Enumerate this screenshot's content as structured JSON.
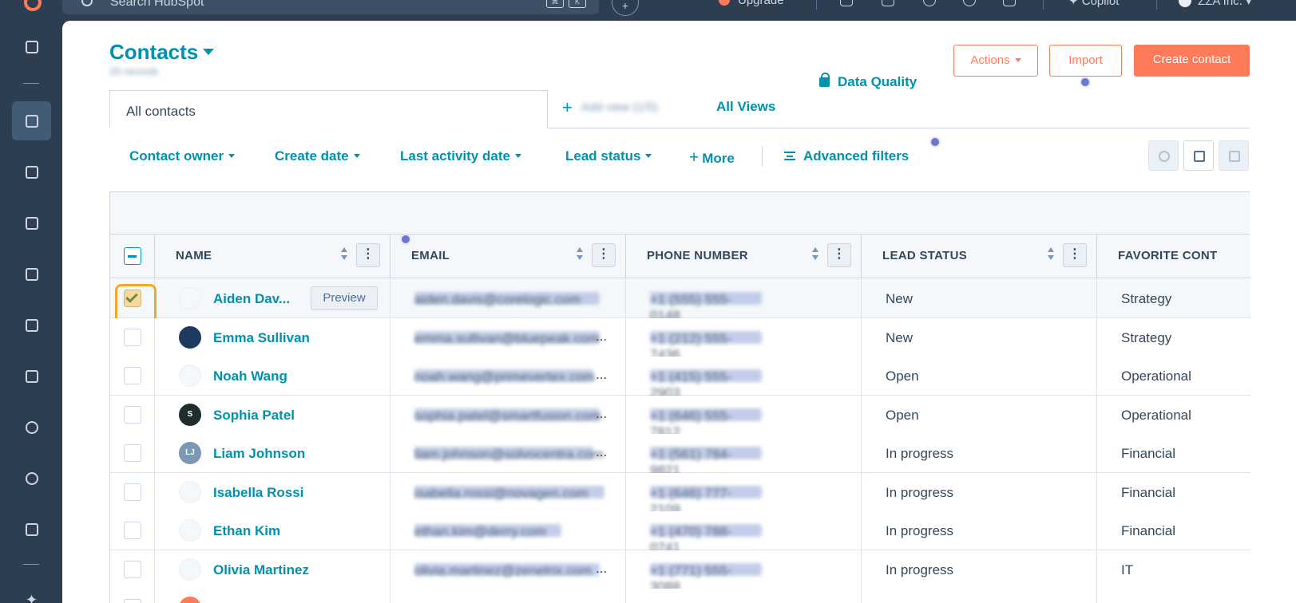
{
  "topbar": {
    "search_placeholder": "Search HubSpot",
    "kbd_cmd": "⌘",
    "kbd_k": "K",
    "plus": "+",
    "upgrade_label": "Upgrade",
    "copilot_label": "Copilot",
    "account_name": "ZZA Inc."
  },
  "sidebar": {
    "items": [
      "bookmarks",
      "contacts",
      "marketing",
      "content",
      "commerce",
      "sales",
      "service",
      "data-management",
      "automation",
      "reporting"
    ],
    "active": "contacts"
  },
  "header": {
    "title": "Contacts",
    "record_count": "20 records",
    "data_quality_label": "Data Quality",
    "actions_label": "Actions",
    "import_label": "Import",
    "create_label": "Create contact"
  },
  "tabs": {
    "active_tab": "All contacts",
    "add_view_label": "Add view (1/5)",
    "all_views_label": "All Views"
  },
  "filters": {
    "items": [
      "Contact owner",
      "Create date",
      "Last activity date",
      "Lead status"
    ],
    "more_label": "More",
    "advanced_label": "Advanced filters"
  },
  "table": {
    "columns": [
      "NAME",
      "EMAIL",
      "PHONE NUMBER",
      "LEAD STATUS",
      "FAVORITE CONT"
    ],
    "preview_label": "Preview",
    "rows": [
      {
        "name": "Aiden Dav...",
        "email": "aiden.davis@corelogic.com",
        "phone": "+1 (555) 555-0148",
        "status": "New",
        "favorite": "Strategy",
        "avatar": "CoreLogic",
        "checked": true
      },
      {
        "name": "Emma Sullivan",
        "email": "emma.sullivan@bluepeak.com",
        "phone": "+1 (212) 555-7436",
        "status": "New",
        "favorite": "Strategy",
        "avatar": "BluePeak",
        "checked": false
      },
      {
        "name": "Noah Wang",
        "email": "noah.wang@primevertex.com",
        "phone": "+1 (415) 555-2903",
        "status": "Open",
        "favorite": "Operational",
        "avatar": "",
        "checked": false
      },
      {
        "name": "Sophia Patel",
        "email": "sophia.patel@smartfusion.com",
        "phone": "+1 (646) 555-7812",
        "status": "Open",
        "favorite": "Operational",
        "avatar": "S",
        "checked": false
      },
      {
        "name": "Liam Johnson",
        "email": "liam.johnson@solvocentra.com",
        "phone": "+1 (561) 784-9821",
        "status": "In progress",
        "favorite": "Financial",
        "avatar": "LJ",
        "checked": false
      },
      {
        "name": "Isabella Rossi",
        "email": "isabella.rossi@novagen.com",
        "phone": "+1 (646) 777-2109",
        "status": "In progress",
        "favorite": "Financial",
        "avatar": "STARRY",
        "checked": false
      },
      {
        "name": "Ethan Kim",
        "email": "ethan.kim@derry.com",
        "phone": "+1 (470) 788-0741",
        "status": "In progress",
        "favorite": "Financial",
        "avatar": "",
        "checked": false
      },
      {
        "name": "Olivia Martinez",
        "email": "olivia.martinez@zenetrix.com",
        "phone": "+1 (771) 555-3088",
        "status": "In progress",
        "favorite": "IT",
        "avatar": "",
        "checked": false
      }
    ]
  },
  "colors": {
    "accent": "#0091ae",
    "brand_orange": "#ff7a59",
    "sidebar_bg": "#2d3e50",
    "highlight": "#f5a623"
  }
}
